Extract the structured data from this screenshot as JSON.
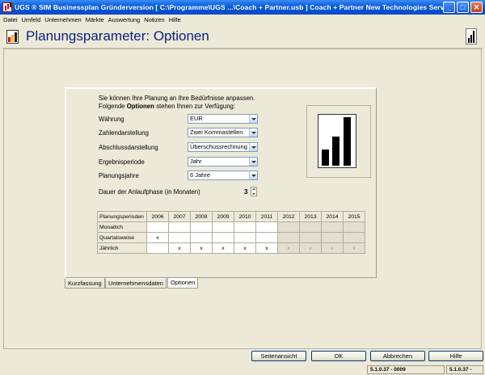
{
  "window": {
    "title": "UGS ® SIM Businessplan Gründerversion  [ C:\\Programme\\UGS ...\\Coach + Partner.usb ] Coach + Partner New Technologies Services (PartG)",
    "minimize": "_",
    "maximize": "□",
    "close": "✕"
  },
  "menu": [
    "Datei",
    "Umfeld",
    "Unternehmen",
    "Märkte",
    "Auswertung",
    "Notizen",
    "Hilfe"
  ],
  "header": {
    "title": "Planungsparameter: Optionen"
  },
  "intro": {
    "line1": "Sie können Ihre Planung an Ihre Bedürfnisse anpassen.",
    "line2_pre": "Folgende ",
    "line2_bold": "Optionen",
    "line2_post": " stehen Ihnen zur Verfügung:"
  },
  "options": [
    {
      "label": "Währung",
      "value": "EUR"
    },
    {
      "label": "Zahlendarstellung",
      "value": "Zwei Kommastellen"
    },
    {
      "label": "Abschlussdarstellung",
      "value": "Überschussrechnung"
    },
    {
      "label": "Ergebnisperiode",
      "value": "Jahr"
    },
    {
      "label": "Planungsjahre",
      "value": "6 Jahre"
    }
  ],
  "dauer": {
    "label": "Dauer der Anlaufphase (in Monaten)",
    "value": "3"
  },
  "grid": {
    "header": "Planungsperioden",
    "years": [
      "2006",
      "2007",
      "2008",
      "2009",
      "2010",
      "2011",
      "2012",
      "2013",
      "2014",
      "2015"
    ],
    "active_years": 6,
    "rows": [
      {
        "label": "Monatlich",
        "marks": [
          "",
          "",
          "",
          "",
          "",
          "",
          "",
          "",
          "",
          ""
        ]
      },
      {
        "label": "Quartalsweise",
        "marks": [
          "x",
          "",
          "",
          "",
          "",
          "",
          "",
          "",
          "",
          ""
        ]
      },
      {
        "label": "Jährlich",
        "marks": [
          "",
          "x",
          "x",
          "x",
          "x",
          "x",
          "x",
          "x",
          "x",
          "x"
        ]
      }
    ]
  },
  "tabs": [
    "Kurzfassung",
    "Unternehmensdaten",
    "Optionen"
  ],
  "buttons": {
    "seitenansicht": "Seitenansicht",
    "ok": "OK",
    "abbrechen": "Abbrechen",
    "hilfe": "Hilfe"
  },
  "status": [
    "5.1.0.37 - 0009",
    "5.1.0.37 -"
  ]
}
